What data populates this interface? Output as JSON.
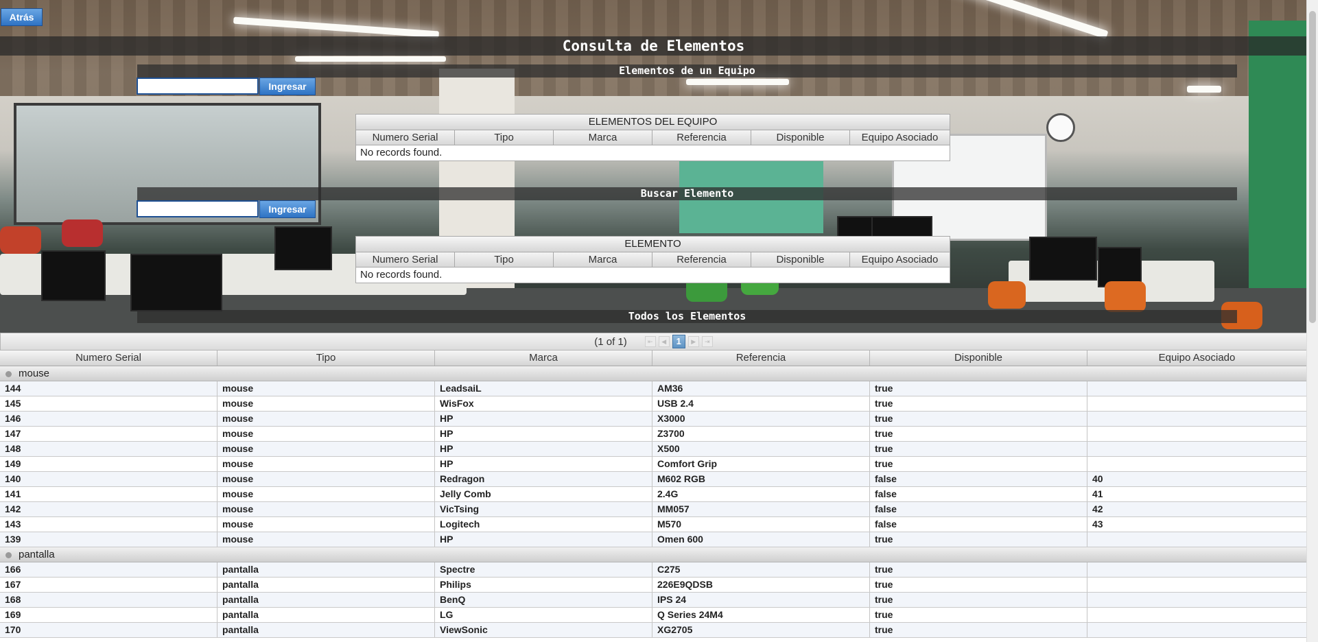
{
  "back_button": "Atrás",
  "page_title": "Consulta de Elementos",
  "section_equipo": {
    "title": "Elementos de un Equipo",
    "input_value": "",
    "button": "Ingresar",
    "table_caption": "ELEMENTOS DEL EQUIPO",
    "columns": [
      "Numero Serial",
      "Tipo",
      "Marca",
      "Referencia",
      "Disponible",
      "Equipo Asociado"
    ],
    "empty_text": "No records found."
  },
  "section_buscar": {
    "title": "Buscar Elemento",
    "input_value": "",
    "button": "Ingresar",
    "table_caption": "ELEMENTO",
    "columns": [
      "Numero Serial",
      "Tipo",
      "Marca",
      "Referencia",
      "Disponible",
      "Equipo Asociado"
    ],
    "empty_text": "No records found."
  },
  "section_todos": {
    "title": "Todos los Elementos",
    "paginator": {
      "text": "(1 of 1)",
      "current_page": "1",
      "controls": [
        "first-icon",
        "prev-icon",
        "next-icon",
        "last-icon"
      ]
    },
    "columns": [
      "Numero Serial",
      "Tipo",
      "Marca",
      "Referencia",
      "Disponible",
      "Equipo Asociado"
    ],
    "groups": [
      {
        "name": "mouse",
        "rows": [
          [
            "144",
            "mouse",
            "LeadsaiL",
            "AM36",
            "true",
            ""
          ],
          [
            "145",
            "mouse",
            "WisFox",
            "USB 2.4",
            "true",
            ""
          ],
          [
            "146",
            "mouse",
            "HP",
            "X3000",
            "true",
            ""
          ],
          [
            "147",
            "mouse",
            "HP",
            "Z3700",
            "true",
            ""
          ],
          [
            "148",
            "mouse",
            "HP",
            "X500",
            "true",
            ""
          ],
          [
            "149",
            "mouse",
            "HP",
            "Comfort Grip",
            "true",
            ""
          ],
          [
            "140",
            "mouse",
            "Redragon",
            "M602 RGB",
            "false",
            "40"
          ],
          [
            "141",
            "mouse",
            "Jelly Comb",
            "2.4G",
            "false",
            "41"
          ],
          [
            "142",
            "mouse",
            "VicTsing",
            "MM057",
            "false",
            "42"
          ],
          [
            "143",
            "mouse",
            "Logitech",
            "M570",
            "false",
            "43"
          ],
          [
            "139",
            "mouse",
            "HP",
            "Omen 600",
            "true",
            ""
          ]
        ]
      },
      {
        "name": "pantalla",
        "rows": [
          [
            "166",
            "pantalla",
            "Spectre",
            "C275",
            "true",
            ""
          ],
          [
            "167",
            "pantalla",
            "Philips",
            "226E9QDSB",
            "true",
            ""
          ],
          [
            "168",
            "pantalla",
            "BenQ",
            "IPS 24",
            "true",
            ""
          ],
          [
            "169",
            "pantalla",
            "LG",
            "Q Series 24M4",
            "true",
            ""
          ],
          [
            "170",
            "pantalla",
            "ViewSonic",
            "XG2705",
            "true",
            ""
          ]
        ]
      }
    ]
  },
  "colors": {
    "button_blue": "#2e73c4",
    "bar_dark": "#2d2d2d",
    "row_alt": "#f2f5fa"
  }
}
